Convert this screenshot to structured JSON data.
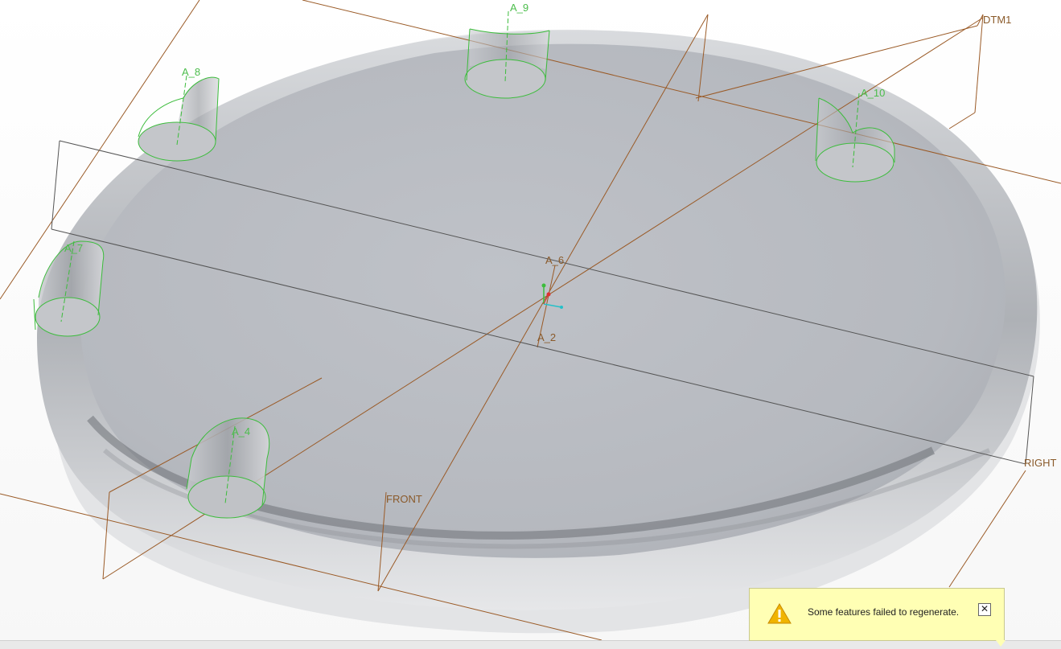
{
  "viewport": {
    "labels": {
      "a9": "A_9",
      "a8": "A_8",
      "a10": "A_10",
      "a7": "A_7",
      "a6": "A_6",
      "a2": "A_2",
      "a4": "A_4",
      "dtm1": "DTM1",
      "right": "RIGHT",
      "front": "FRONT"
    },
    "colors": {
      "datum_plane": "#9a5a26",
      "axis": "#8a5a2a",
      "feature_edge": "#3cbc3c",
      "model_edge": "#6b6b6b",
      "model_surface": "#b9bcc2"
    }
  },
  "notification": {
    "icon": "warning-icon",
    "message": "Some features failed to regenerate.",
    "close_label": "✕"
  }
}
